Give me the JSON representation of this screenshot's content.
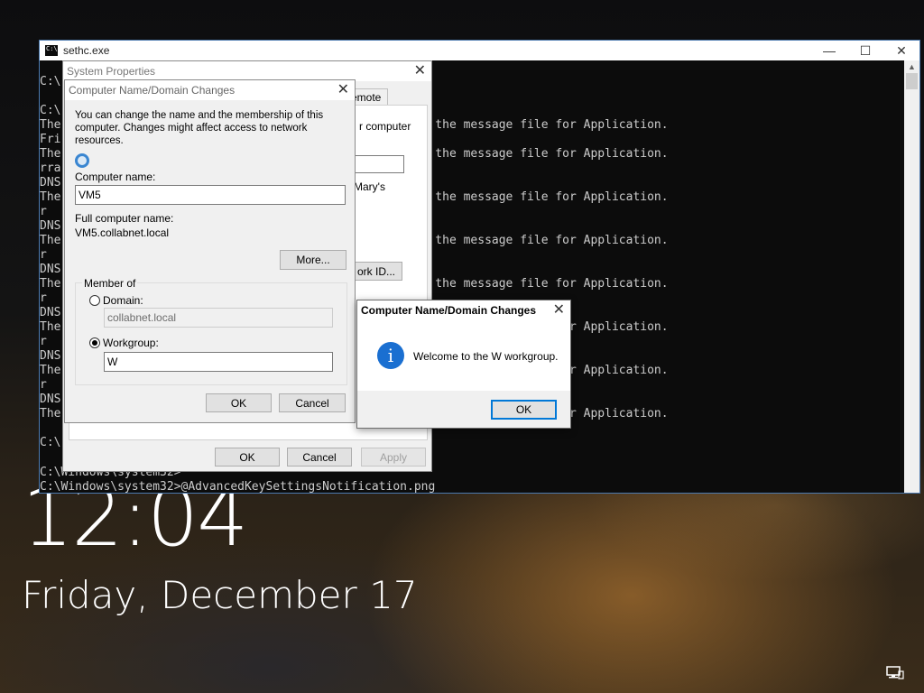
{
  "lockscreen": {
    "time": "12:04",
    "date": "Friday, December 17"
  },
  "console": {
    "title": "sethc.exe",
    "lines": [
      "",
      "C:\\",
      "",
      "C:\\",
      "The                                           0x2337 in the message file for Application.",
      "Fri",
      "The                                           0x2342 in the message file for Application.",
      "rra",
      "DNS",
      "The                                           0x2342 in the message file for Application.",
      "r",
      "DNS",
      "The                                           0x2342 in the message file for Application.",
      "r",
      "DNS",
      "The                                           0x2342 in the message file for Application.",
      "r",
      "DNS",
      "The                                           0x2342 in the message file for Application.",
      "r",
      "DNS",
      "The                                           0x2342 in the message file for Application.",
      "r",
      "DNS",
      "The                                           0x2342 in the message file for Application.",
      "",
      "C:\\"
    ],
    "prompt1": "C:\\Windows\\system32>",
    "prompt2": "C:\\Windows\\system32>@AdvancedKeySettingsNotification.png",
    "maximize": "☐",
    "close": "✕",
    "minimize": "—"
  },
  "system_properties": {
    "title": "System Properties",
    "remote_tab": "emote",
    "computer_text": "r computer",
    "marys": "Mary's",
    "network_id": "ork ID...",
    "ok": "OK",
    "cancel": "Cancel",
    "apply": "Apply"
  },
  "name_dialog": {
    "title": "Computer Name/Domain Changes",
    "intro": "You can change the name and the membership of this computer. Changes might affect access to network resources.",
    "computer_name_label": "Computer name:",
    "computer_name_value": "VM5",
    "full_name_label": "Full computer name:",
    "full_name_value": "VM5.collabnet.local",
    "more": "More...",
    "member_of": "Member of",
    "domain_label": "Domain:",
    "domain_value": "collabnet.local",
    "workgroup_label": "Workgroup:",
    "workgroup_value": "W",
    "ok": "OK",
    "cancel": "Cancel"
  },
  "welcome_dialog": {
    "title": "Computer Name/Domain Changes",
    "message": "Welcome to the W workgroup.",
    "ok": "OK"
  }
}
